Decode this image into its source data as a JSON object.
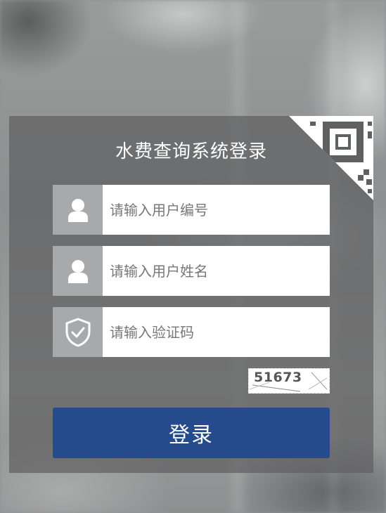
{
  "login": {
    "title": "水费查询系统登录",
    "fields": [
      {
        "icon": "user-icon",
        "placeholder": "请输入用户编号",
        "value": ""
      },
      {
        "icon": "user-icon",
        "placeholder": "请输入用户姓名",
        "value": ""
      },
      {
        "icon": "shield-check-icon",
        "placeholder": "请输入验证码",
        "value": ""
      }
    ],
    "captcha_text": "51673",
    "submit_label": "登录",
    "qr_corner_icon": "qr-code-icon"
  },
  "colors": {
    "button": "#254b8c",
    "icon_box": "#a8a9aa",
    "panel": "#5f6061"
  }
}
